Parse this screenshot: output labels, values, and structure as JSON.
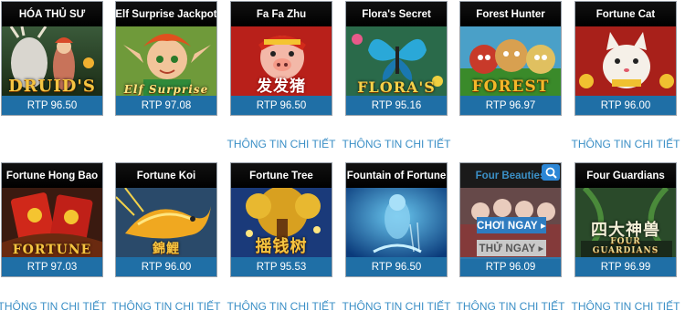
{
  "games_row1": [
    {
      "title": "HÓA THỦ SƯ",
      "rtp": "RTP 96.50",
      "logo": "DRUID'S",
      "info": ""
    },
    {
      "title": "Elf Surprise Jackpot",
      "rtp": "RTP 97.08",
      "logo": "Elf Surprise",
      "info": ""
    },
    {
      "title": "Fa Fa Zhu",
      "rtp": "RTP 96.50",
      "logo": "发发猪",
      "info": "THÔNG TIN CHI TIẾT"
    },
    {
      "title": "Flora's Secret",
      "rtp": "RTP 95.16",
      "logo": "FLORA'S",
      "info": "THÔNG TIN CHI TIẾT"
    },
    {
      "title": "Forest Hunter",
      "rtp": "RTP 96.97",
      "logo": "FOREST",
      "info": ""
    },
    {
      "title": "Fortune Cat",
      "rtp": "RTP 96.00",
      "logo": "",
      "info": "THÔNG TIN CHI TIẾT"
    }
  ],
  "games_row2": [
    {
      "title": "Fortune Hong Bao",
      "rtp": "RTP 97.03",
      "logo": "FORTUNE",
      "info": "THÔNG TIN CHI TIẾT"
    },
    {
      "title": "Fortune Koi",
      "rtp": "RTP 96.00",
      "logo": "錦鯉",
      "info": "THÔNG TIN CHI TIẾT"
    },
    {
      "title": "Fortune Tree",
      "rtp": "RTP 95.53",
      "logo": "摇钱树",
      "info": "THÔNG TIN CHI TIẾT"
    },
    {
      "title": "Fountain of Fortune",
      "rtp": "RTP 96.50",
      "logo": "",
      "info": "THÔNG TIN CHI TIẾT"
    },
    {
      "title": "Four Beauties",
      "rtp": "RTP 96.09",
      "logo": "",
      "info": "THÔNG TIN CHI TIẾT",
      "play": "CHƠI NGAY ▸",
      "try": "THỬ NGAY ▸"
    },
    {
      "title": "Four Guardians",
      "rtp": "RTP 96.99",
      "logo": "四大神兽",
      "logo2": "FOUR GUARDIANS",
      "info": "THÔNG TIN CHI TIẾT"
    }
  ],
  "icons": {
    "magnify": "magnify-icon"
  },
  "colors": {
    "rtp_bar": "#1f6fa6",
    "info_link": "#3b8fc6",
    "play_button": "#2f7cc0"
  }
}
